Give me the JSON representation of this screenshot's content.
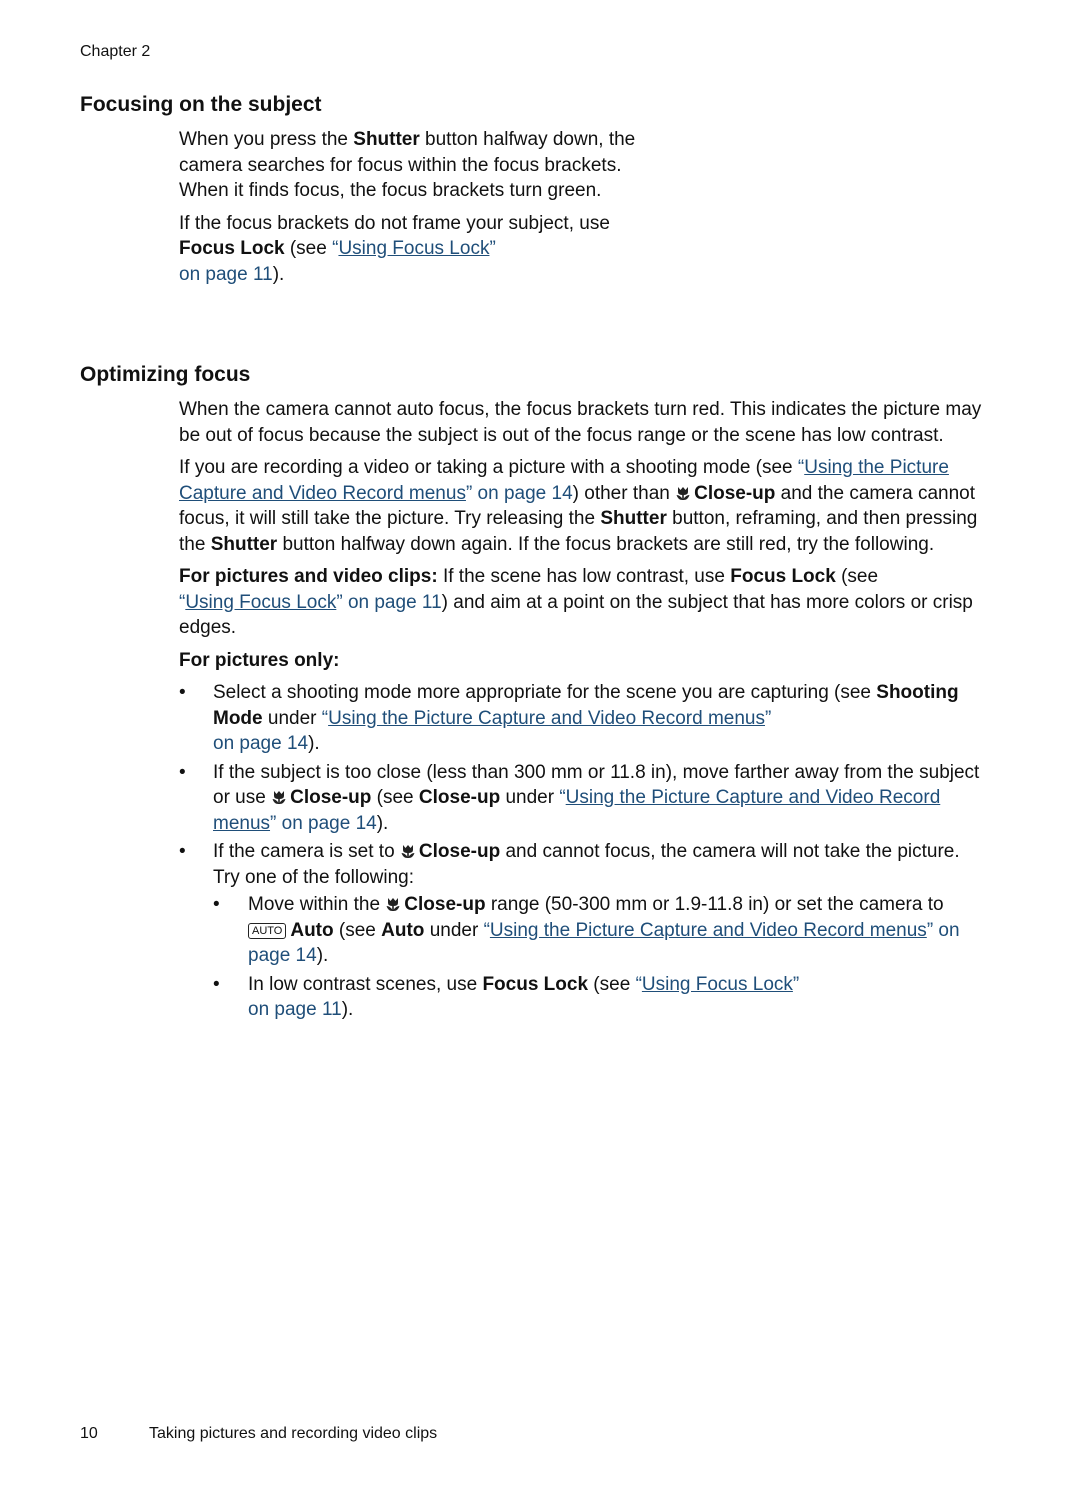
{
  "header": {
    "chapter": "Chapter 2"
  },
  "section1": {
    "title": "Focusing on the subject",
    "p1": {
      "a": "When you press the ",
      "b1": "Shutter",
      "c": " button halfway down, the camera searches for focus within the focus brackets. When it finds focus, the focus brackets turn green."
    },
    "p2": {
      "a": "If the focus brackets do not frame your subject, use ",
      "b1": "Focus Lock",
      "c": " (see ",
      "q1": "“",
      "link": "Using Focus Lock",
      "q2": "”",
      "page": " on page 11",
      "d": ")."
    }
  },
  "section2": {
    "title": "Optimizing focus",
    "p1": "When the camera cannot auto focus, the focus brackets turn red. This indicates the picture may be out of focus because the subject is out of the focus range or the scene has low contrast.",
    "p2": {
      "a": "If you are recording a video or taking a picture with a shooting mode (see ",
      "q1": "“",
      "link": "Using the Picture Capture and Video Record menus",
      "q2": "”",
      "page": " on page 14",
      "b": ") other than ",
      "icon": "macro-icon",
      "b1": "Close-up",
      "c": " and the camera cannot focus, it will still take the picture. Try releasing the ",
      "b2": "Shutter",
      "d": " button, reframing, and then pressing the ",
      "b3": "Shutter",
      "e": " button halfway down again. If the focus brackets are still red, try the following."
    },
    "p3": {
      "b1": "For pictures and video clips:",
      "a": " If the scene has low contrast, use ",
      "b2": "Focus Lock",
      "c": " (see ",
      "q1": "“",
      "link": "Using Focus Lock",
      "q2": "”",
      "page": " on page 11",
      "d": ") and aim at a point on the subject that has more colors or crisp edges."
    },
    "subhead": "For pictures only:",
    "bullets": [
      {
        "a": "Select a shooting mode more appropriate for the scene you are capturing (see ",
        "b1": "Shooting Mode",
        "c": " under ",
        "q1": "“",
        "link": "Using the Picture Capture and Video Record menus",
        "q2": "”",
        "page": " on page 14",
        "d": ")."
      },
      {
        "a": "If the subject is too close (less than 300 mm or 11.8 in), move farther away from the subject or use ",
        "b1": "Close-up",
        "c": " (see ",
        "b2": "Close-up",
        "e": " under ",
        "q1": "“",
        "link": "Using the Picture Capture and Video Record menus",
        "q2": "”",
        "page": " on page 14",
        "d": ")."
      },
      {
        "a": "If the camera is set to ",
        "b1": "Close-up",
        "c": " and cannot focus, the camera will not take the picture. Try one of the following:"
      }
    ],
    "subbullets": [
      {
        "a": "Move within the ",
        "b1": "Close-up",
        "c": " range (50-300 mm or 1.9-11.8 in) or set the camera to ",
        "auto_icon": "AUTO",
        "b2": "Auto",
        "e": " (see ",
        "b3": "Auto",
        "f": " under ",
        "q1": "“",
        "link": "Using the Picture Capture and Video Record menus",
        "q2": "”",
        "page": " on page 14",
        "d": ")."
      },
      {
        "a": "In low contrast scenes, use ",
        "b1": "Focus Lock",
        "c": " (see ",
        "q1": "“",
        "link": "Using Focus Lock",
        "q2": "”",
        "page": " on page 11",
        "d": ")."
      }
    ]
  },
  "footer": {
    "page_number": "10",
    "title": "Taking pictures and recording video clips"
  },
  "colors": {
    "link": "#1f4e79",
    "text": "#111111"
  }
}
